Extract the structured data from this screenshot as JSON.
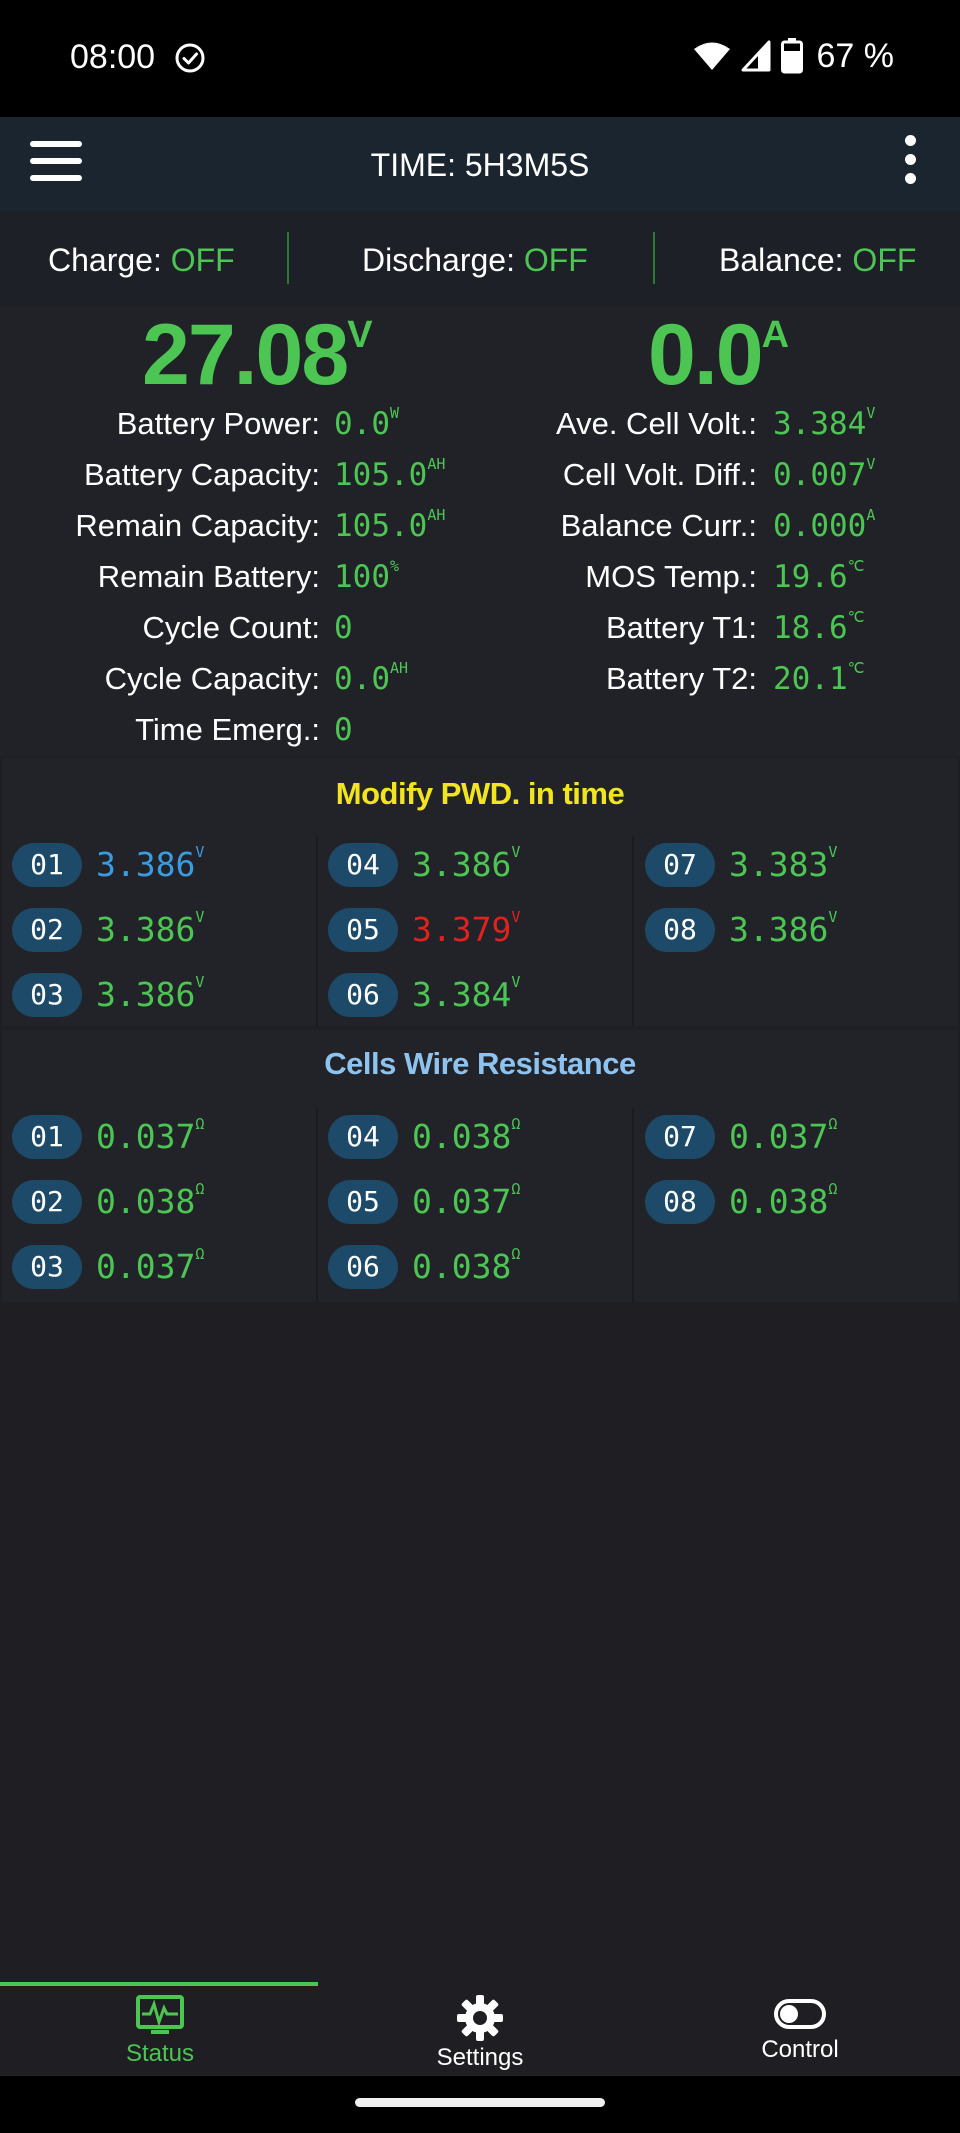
{
  "status_bar": {
    "time": "08:00",
    "battery_percent": "67 %"
  },
  "app_bar": {
    "title": "TIME: 5H3M5S"
  },
  "switches": [
    {
      "label": "Charge: ",
      "value": "OFF"
    },
    {
      "label": "Discharge: ",
      "value": "OFF"
    },
    {
      "label": "Balance: ",
      "value": "OFF"
    }
  ],
  "overview": {
    "voltage": {
      "value": "27.08",
      "unit": "V"
    },
    "current": {
      "value": "0.0",
      "unit": "A"
    },
    "left": [
      {
        "label": "Battery Power:",
        "value": "0.0",
        "unit": "W"
      },
      {
        "label": "Battery Capacity:",
        "value": "105.0",
        "unit": "AH"
      },
      {
        "label": "Remain Capacity:",
        "value": "105.0",
        "unit": "AH"
      },
      {
        "label": "Remain Battery:",
        "value": "100",
        "unit": "%"
      },
      {
        "label": "Cycle Count:",
        "value": "0",
        "unit": ""
      },
      {
        "label": "Cycle Capacity:",
        "value": "0.0",
        "unit": "AH"
      },
      {
        "label": "Time Emerg.:",
        "value": "0",
        "unit": ""
      }
    ],
    "right": [
      {
        "label": "Ave. Cell Volt.:",
        "value": "3.384",
        "unit": "V"
      },
      {
        "label": "Cell Volt. Diff.:",
        "value": "0.007",
        "unit": "V"
      },
      {
        "label": "Balance Curr.:",
        "value": "0.000",
        "unit": "A"
      },
      {
        "label": "MOS Temp.:",
        "value": "19.6",
        "unit": "℃"
      },
      {
        "label": "Battery T1:",
        "value": "18.6",
        "unit": "℃"
      },
      {
        "label": "Battery T2:",
        "value": "20.1",
        "unit": "℃"
      }
    ]
  },
  "cells_section": {
    "title": "Modify PWD. in time",
    "unit": "V",
    "cells": [
      {
        "id": "01",
        "value": "3.386",
        "status": "max"
      },
      {
        "id": "02",
        "value": "3.386",
        "status": "normal"
      },
      {
        "id": "03",
        "value": "3.386",
        "status": "normal"
      },
      {
        "id": "04",
        "value": "3.386",
        "status": "normal"
      },
      {
        "id": "05",
        "value": "3.379",
        "status": "min"
      },
      {
        "id": "06",
        "value": "3.384",
        "status": "normal"
      },
      {
        "id": "07",
        "value": "3.383",
        "status": "normal"
      },
      {
        "id": "08",
        "value": "3.386",
        "status": "normal"
      }
    ]
  },
  "resistance_section": {
    "title": "Cells Wire Resistance",
    "unit": "Ω",
    "cells": [
      {
        "id": "01",
        "value": "0.037"
      },
      {
        "id": "02",
        "value": "0.038"
      },
      {
        "id": "03",
        "value": "0.037"
      },
      {
        "id": "04",
        "value": "0.038"
      },
      {
        "id": "05",
        "value": "0.037"
      },
      {
        "id": "06",
        "value": "0.038"
      },
      {
        "id": "07",
        "value": "0.037"
      },
      {
        "id": "08",
        "value": "0.038"
      }
    ]
  },
  "bottom_nav": [
    {
      "label": "Status",
      "icon": "monitor-pulse-icon",
      "active": true
    },
    {
      "label": "Settings",
      "icon": "gear-icon",
      "active": false
    },
    {
      "label": "Control",
      "icon": "toggle-icon",
      "active": false
    }
  ],
  "colors": {
    "accent_green": "#4cc553",
    "title_yellow": "#f2e520",
    "title_blue": "#8ec3ef",
    "max_blue": "#3b9be0",
    "min_red": "#e0211e",
    "badge_bg": "#1e4a6a"
  }
}
